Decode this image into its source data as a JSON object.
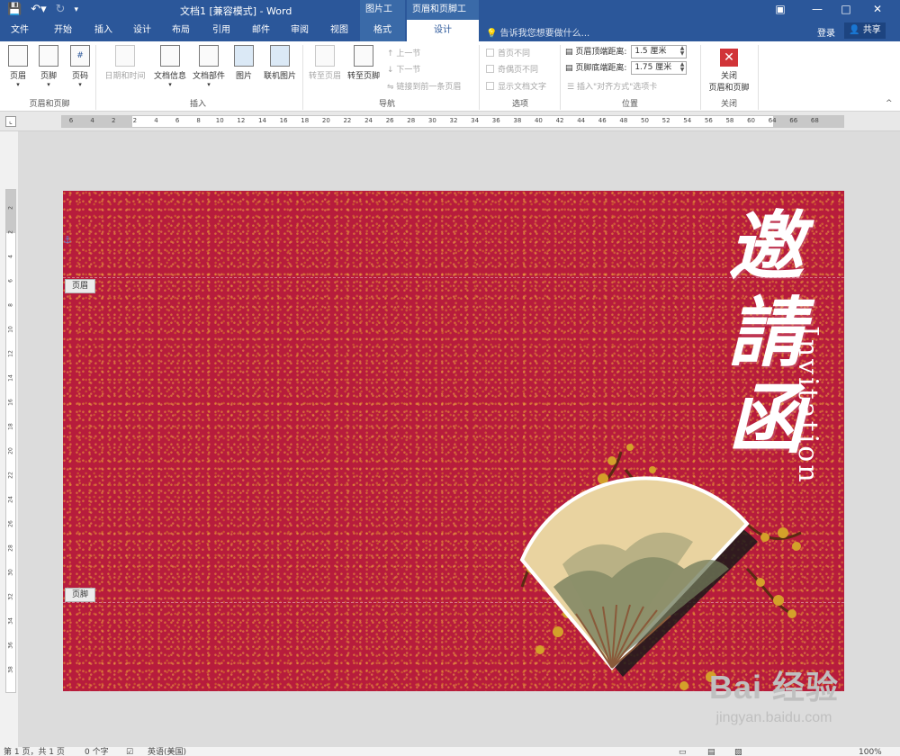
{
  "titlebar": {
    "document_title": "文档1 [兼容模式] - Word",
    "ctx_picture_tools": "图片工具",
    "ctx_header_footer_tools": "页眉和页脚工具",
    "window_buttons": [
      "restore-icon",
      "minimize-icon",
      "maximize-icon",
      "close-icon"
    ],
    "accent_color": "#2b579a"
  },
  "tabs": [
    "文件",
    "开始",
    "插入",
    "设计",
    "布局",
    "引用",
    "邮件",
    "审阅",
    "视图",
    "格式",
    "设计"
  ],
  "active_tab": "设计",
  "tell_me": "告诉我您想要做什么...",
  "login": "登录",
  "share": "共享",
  "ribbon": {
    "header": "页眉",
    "footer": "页脚",
    "page_number": "页码",
    "group_hf": "页眉和页脚",
    "date_time": "日期和时间",
    "doc_info": "文档信息",
    "doc_parts": "文档部件",
    "picture": "图片",
    "online_picture": "联机图片",
    "group_insert": "插入",
    "goto_header": "转至页眉",
    "goto_footer": "转至页脚",
    "prev_section": "上一节",
    "next_section": "下一节",
    "link_prev": "链接到前一条页眉",
    "group_nav": "导航",
    "first_page_diff": "首页不同",
    "odd_even_diff": "奇偶页不同",
    "show_doc_text": "显示文档文字",
    "group_options": "选项",
    "header_top_label": "页眉顶端距离:",
    "header_top_value": "1.5 厘米",
    "footer_bottom_label": "页脚底端距离:",
    "footer_bottom_value": "1.75 厘米",
    "insert_align_tab": "插入\"对齐方式\"选项卡",
    "group_position": "位置",
    "close_hf_line1": "关闭",
    "close_hf_line2": "页眉和页脚",
    "group_close": "关闭"
  },
  "ruler": {
    "h_ticks": [
      "6",
      "4",
      "2",
      "2",
      "4",
      "6",
      "8",
      "10",
      "12",
      "14",
      "16",
      "18",
      "20",
      "22",
      "24",
      "26",
      "28",
      "30",
      "32",
      "34",
      "36",
      "38",
      "40",
      "42",
      "44",
      "46",
      "48",
      "50",
      "52",
      "54",
      "56",
      "58",
      "60",
      "64",
      "66",
      "68"
    ],
    "v_ticks": [
      "2",
      "2",
      "4",
      "6",
      "8",
      "10",
      "12",
      "14",
      "16",
      "18",
      "20",
      "22",
      "24",
      "26",
      "28",
      "30",
      "32",
      "34",
      "36",
      "38"
    ]
  },
  "page": {
    "header_tag": "页眉",
    "footer_tag": "页脚",
    "calligraphy": "邀\n請\n函",
    "invitation": "Invitation",
    "background_color": "#b71c3c"
  },
  "statusbar": {
    "page": "第 1 页，共 1 页",
    "words": "0 个字",
    "lang": "英语(美国)",
    "zoom": "100%"
  },
  "watermark": {
    "brand": "Bai 经验",
    "url": "jingyan.baidu.com"
  }
}
